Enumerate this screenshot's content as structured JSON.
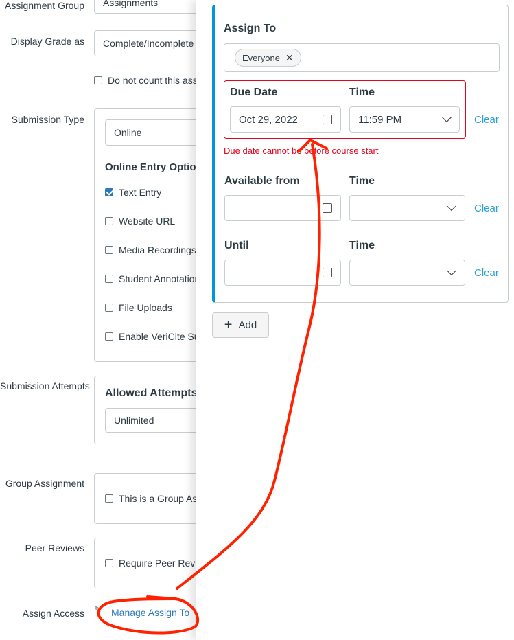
{
  "form": {
    "assignment_group": {
      "label": "Assignment Group",
      "value": "Assignments"
    },
    "display_grade": {
      "label": "Display Grade as",
      "value": "Complete/Incomplete"
    },
    "do_not_count": {
      "label": "Do not count this assignment towards the final grade",
      "checked": false
    },
    "submission_type": {
      "label": "Submission Type",
      "value": "Online",
      "options_heading": "Online Entry Options",
      "options": [
        {
          "label": "Text Entry",
          "checked": true
        },
        {
          "label": "Website URL",
          "checked": false
        },
        {
          "label": "Media Recordings",
          "checked": false
        },
        {
          "label": "Student Annotation",
          "checked": false
        },
        {
          "label": "File Uploads",
          "checked": false
        },
        {
          "label": "Enable VeriCite Submissions",
          "checked": false
        }
      ]
    },
    "submission_attempts": {
      "label": "Submission Attempts",
      "heading": "Allowed Attempts",
      "value": "Unlimited"
    },
    "group_assignment": {
      "label": "Group Assignment",
      "checkbox": "This is a Group Assignment",
      "checked": false
    },
    "peer_reviews": {
      "label": "Peer Reviews",
      "checkbox": "Require Peer Reviews",
      "checked": false
    },
    "assign_access": {
      "label": "Assign Access",
      "link": "Manage Assign To"
    }
  },
  "tray": {
    "assign_to_label": "Assign To",
    "assignee_chip": "Everyone",
    "due_date_label": "Due Date",
    "due_date_value": "Oct 29, 2022",
    "time_label": "Time",
    "due_time_value": "11:59 PM",
    "clear_label": "Clear",
    "error": "Due date cannot be before course start",
    "available_from_label": "Available from",
    "until_label": "Until",
    "add_label": "Add",
    "accent": "#0096db",
    "error_color": "#e0061f"
  },
  "annotation_color": "#ff2200"
}
